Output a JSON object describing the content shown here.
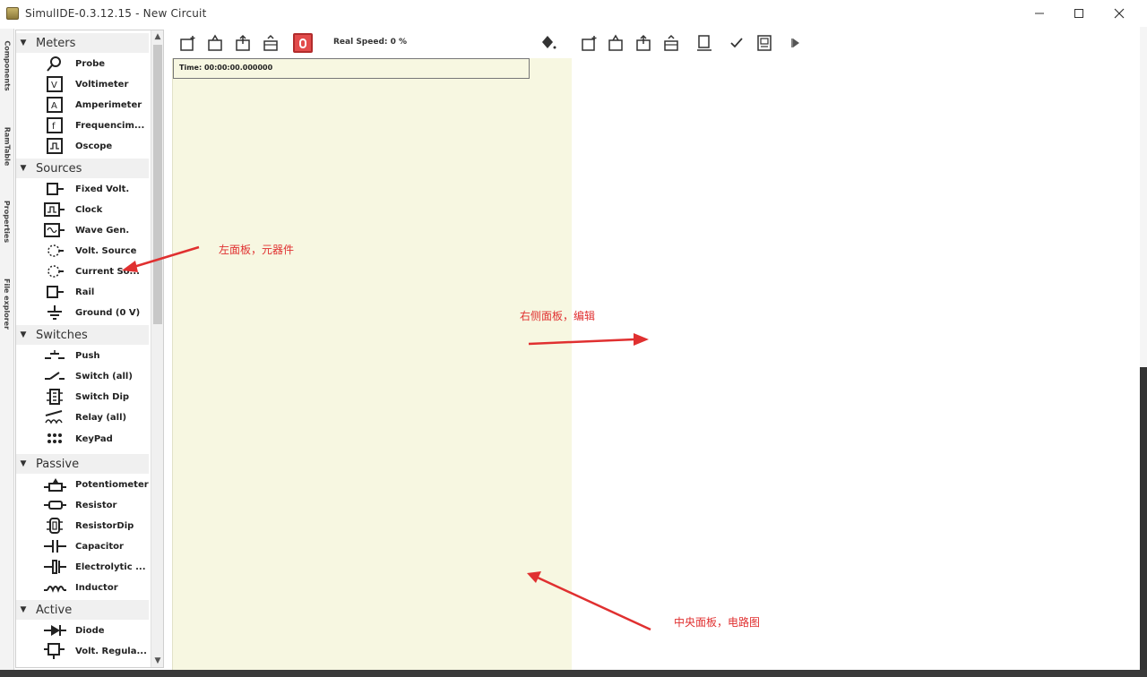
{
  "window": {
    "title": "SimulIDE-0.3.12.15 - New Circuit",
    "minimize_icon": "minimize-icon",
    "maximize_icon": "maximize-icon",
    "close_icon": "close-icon"
  },
  "side_tabs": [
    "Components",
    "RamTable",
    "Properties",
    "File explorer"
  ],
  "components": {
    "categories": [
      {
        "label": "Meters",
        "items": [
          "Probe",
          "Voltimeter",
          "Amperimeter",
          "Frequencim...",
          "Oscope"
        ]
      },
      {
        "label": "Sources",
        "items": [
          "Fixed Volt.",
          "Clock",
          "Wave Gen.",
          "Volt. Source",
          "Current So...",
          "Rail",
          "Ground (0 V)"
        ]
      },
      {
        "label": "Switches",
        "items": [
          "Push",
          "Switch (all)",
          "Switch Dip",
          "Relay (all)",
          "KeyPad"
        ]
      },
      {
        "label": "Passive",
        "items": [
          "Potentiometer",
          "Resistor",
          "ResistorDip",
          "Capacitor",
          "Electrolytic ...",
          "Inductor"
        ]
      },
      {
        "label": "Active",
        "items": [
          "Diode",
          "Volt. Regula..."
        ]
      }
    ]
  },
  "circuit_toolbar": {
    "icons": [
      "new-circuit-icon",
      "open-circuit-icon",
      "save-circuit-icon",
      "save-as-icon",
      "power-icon"
    ],
    "real_speed": "Real Speed: 0 %",
    "settings_icon": "settings-icon"
  },
  "editor_toolbar": {
    "icons": [
      "new-file-icon",
      "open-file-icon",
      "save-file-icon",
      "save-as-file-icon",
      "find-icon",
      "compile-icon",
      "load-icon",
      "debug-icon"
    ]
  },
  "circuit": {
    "time": "Time: 00:00:00.000000"
  },
  "annotations": {
    "left": "左面板，元器件",
    "right": "右侧面板，编辑",
    "center": "中央面板，电路图"
  },
  "colors": {
    "circuit_bg": "#f7f7e1",
    "annotation": "#e03030",
    "power_button": "#e24b4b"
  }
}
